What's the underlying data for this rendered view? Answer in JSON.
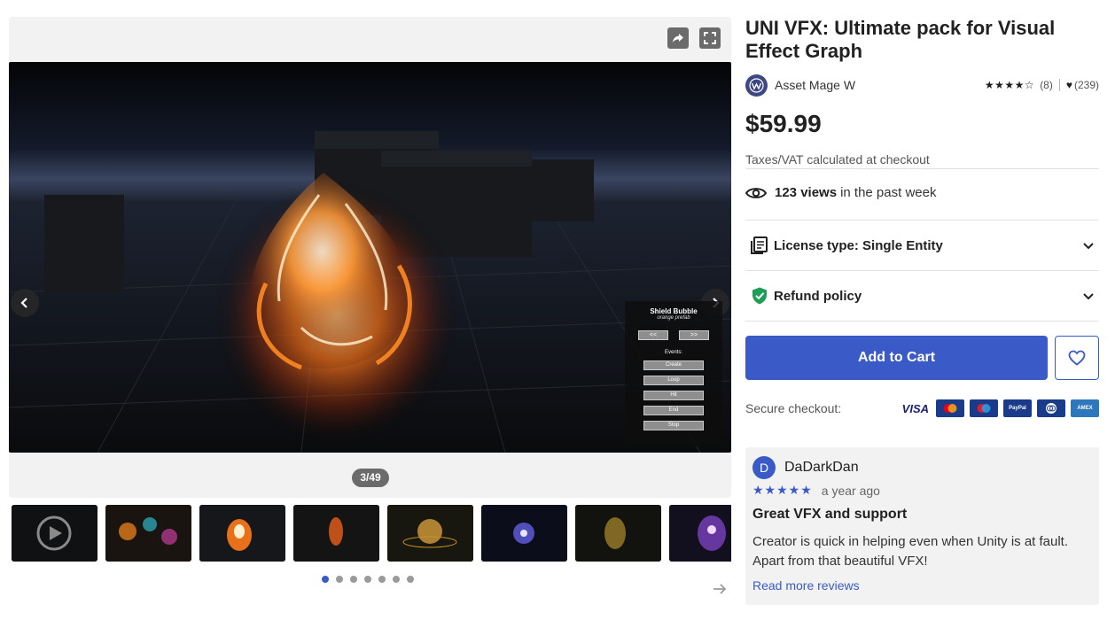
{
  "gallery": {
    "counter": "3/49",
    "hud": {
      "title": "Shield Bubble",
      "subtitle": "orange prefab",
      "prev": "<<",
      "next": ">>",
      "events_label": "Events:",
      "events": [
        "Create",
        "Loop",
        "Hit",
        "End",
        "Stop"
      ]
    },
    "thumbnail_count": 8,
    "dot_count": 7,
    "active_dot": 1
  },
  "product": {
    "title": "UNI VFX: Ultimate pack for Visual Effect Graph",
    "publisher": "Asset Mage W",
    "rating_stars": 4,
    "rating_count": "(8)",
    "favorites": "(239)",
    "price": "$59.99",
    "tax_note": "Taxes/VAT calculated at checkout",
    "views_count": "123 views",
    "views_suffix": "in the past week",
    "license_label": "License type: Single Entity",
    "refund_label": "Refund policy",
    "add_to_cart": "Add to Cart",
    "secure_checkout": "Secure checkout:",
    "payment_methods": [
      "VISA",
      "Mastercard",
      "Maestro",
      "PayPal",
      "Diners",
      "AMEX"
    ]
  },
  "review": {
    "avatar_letter": "D",
    "user": "DaDarkDan",
    "stars": 5,
    "time": "a year ago",
    "title": "Great VFX and support",
    "body": "Creator is quick in helping even when Unity is at fault. Apart from that beautiful VFX!",
    "read_more": "Read more reviews"
  },
  "colors": {
    "accent": "#3a5bc7",
    "text": "#212121",
    "panel": "#f2f2f2",
    "refund_shield": "#1e9e56"
  }
}
